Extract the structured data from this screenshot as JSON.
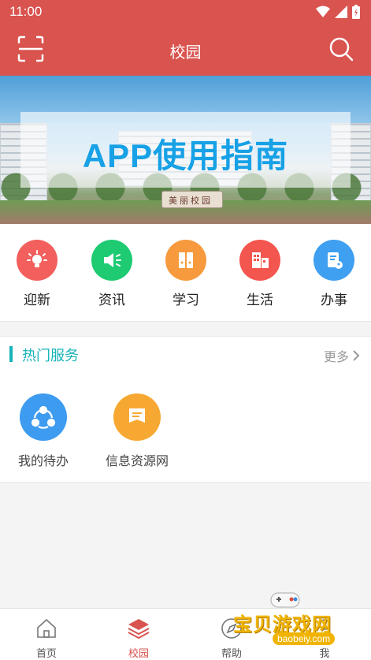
{
  "status_bar": {
    "time": "11:00"
  },
  "app_bar": {
    "title": "校园"
  },
  "banner": {
    "headline": "APP使用指南",
    "stone_text": "美丽校园"
  },
  "quick_menu": [
    {
      "label": "迎新",
      "icon": "lightbulb-icon",
      "color": "#f25f5c"
    },
    {
      "label": "资讯",
      "icon": "megaphone-icon",
      "color": "#1ecb73"
    },
    {
      "label": "学习",
      "icon": "books-icon",
      "color": "#f79a3e"
    },
    {
      "label": "生活",
      "icon": "building-icon",
      "color": "#f2564f"
    },
    {
      "label": "办事",
      "icon": "document-icon",
      "color": "#3f9ff0"
    }
  ],
  "hot_services": {
    "title": "热门服务",
    "more_label": "更多",
    "items": [
      {
        "label": "我的待办",
        "icon": "share-network-icon",
        "color": "#3d9bf0"
      },
      {
        "label": "信息资源网",
        "icon": "message-icon",
        "color": "#f7a832"
      }
    ]
  },
  "tab_bar": {
    "active": "校园",
    "items": [
      {
        "label": "首页",
        "icon": "home-icon"
      },
      {
        "label": "校园",
        "icon": "layers-icon"
      },
      {
        "label": "帮助",
        "icon": "compass-icon"
      },
      {
        "label": "我",
        "icon": "user-icon"
      }
    ]
  },
  "watermark": {
    "title": "宝贝游戏网",
    "url": "baobeiy.com"
  }
}
